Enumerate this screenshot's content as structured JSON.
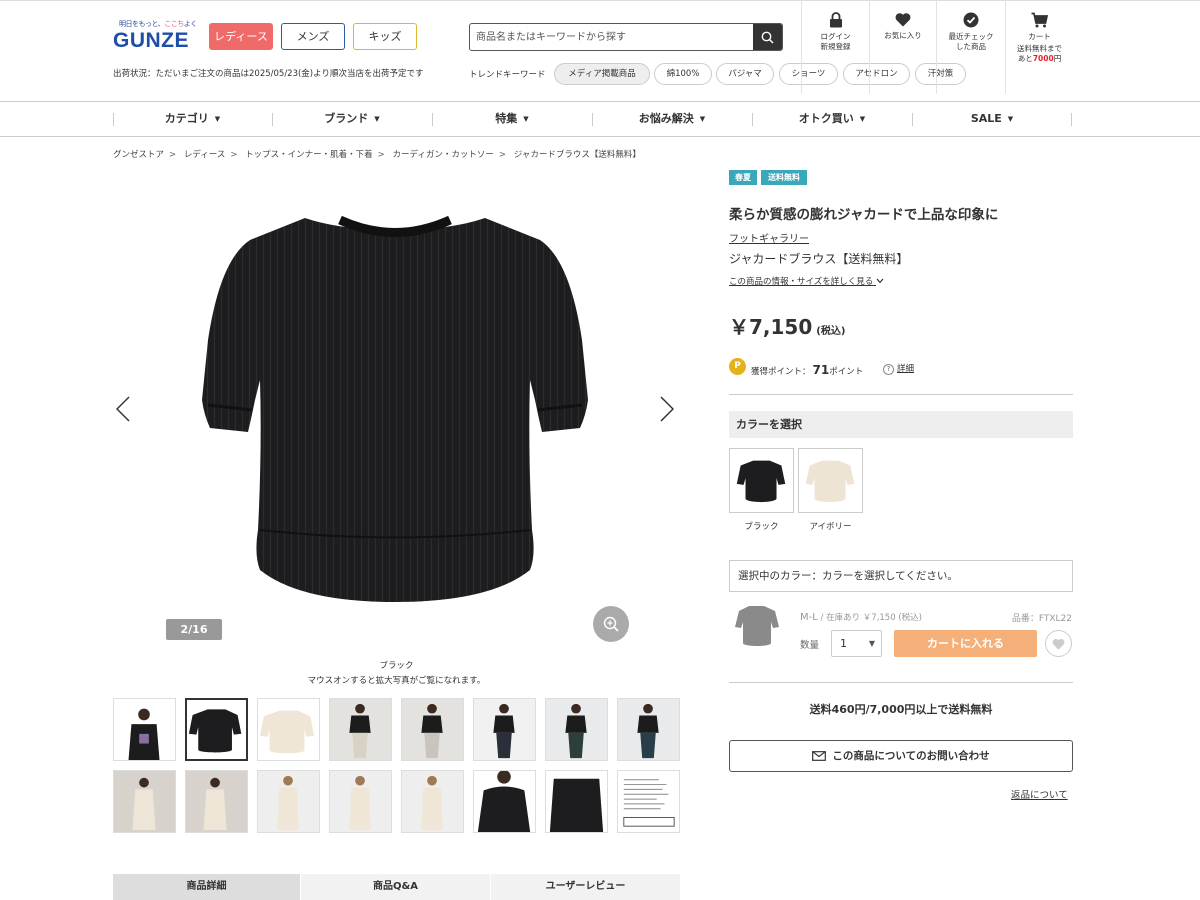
{
  "header": {
    "logo_tagline_pre": "明日をもっと、",
    "logo_tagline_accent": "ここち",
    "logo_tagline_post": "よく",
    "logo_word": "GUNZE",
    "gender_tabs": [
      "レディース",
      "メンズ",
      "キッズ"
    ],
    "shipping_notice": "出荷状況：ただいまご注文の商品は2025/05/23(金)より順次当店を出荷予定です",
    "search_placeholder": "商品名またはキーワードから探す",
    "trend_label": "トレンドキーワード",
    "trend_pills": [
      "メディア掲載商品",
      "綿100%",
      "パジャマ",
      "ショーツ",
      "アセドロン",
      "汗対策"
    ],
    "util": {
      "login_1": "ログイン",
      "login_2": "新規登録",
      "favorites": "お気に入り",
      "recent_1": "最近チェック",
      "recent_2": "した商品",
      "cart": "カート",
      "cart_note_1": "送料無料まで",
      "cart_note_2a": "あと",
      "cart_note_2b": "7000",
      "cart_note_2c": "円"
    }
  },
  "nav": [
    "カテゴリ",
    "ブランド",
    "特集",
    "お悩み解決",
    "オトク買い",
    "SALE"
  ],
  "breadcrumb": [
    "グンゼストア",
    "レディース",
    "トップス・インナー・肌着・下着",
    "カーディガン・カットソー",
    "ジャカードブラウス【送料無料】"
  ],
  "gallery": {
    "counter": "2/16",
    "caption_color": "ブラック",
    "caption_hint": "マウスオンすると拡大写真がご覧になれます。"
  },
  "tabs": [
    "商品詳細",
    "商品Q&A",
    "ユーザーレビュー"
  ],
  "product": {
    "badges": [
      "春夏",
      "送料無料"
    ],
    "headline": "柔らか質感の膨れジャカードで上品な印象に",
    "brand": "フットギャラリー",
    "name": "ジャカードブラウス【送料無料】",
    "details_link": "この商品の情報・サイズを詳しく見る",
    "price": "￥7,150",
    "tax": "(税込)",
    "points_icon": "P",
    "points_label": "獲得ポイント：",
    "points_value": "71",
    "points_unit": "ポイント",
    "points_help": "詳細",
    "color_heading": "カラーを選択",
    "colors": [
      "ブラック",
      "アイボリー"
    ],
    "selected_color_msg": "選択中のカラー：カラーを選択してください。",
    "sku_size": "M-L",
    "sku_stock": " / 在庫あり ￥7,150 (税込)",
    "sku_code": "品番：FTXL22",
    "qty_label": "数量",
    "qty_value": "1",
    "add_to_cart": "カートに入れる",
    "shipping_fee": "送料460円/7,000円以上で送料無料",
    "inquiry": "この商品についてのお問い合わせ",
    "returns": "返品について"
  },
  "colors": {
    "ladies": "#f06a6a",
    "logo_blue": "#1e4ea8",
    "badge_teal": "#3aa8b8",
    "cart_orange": "#f5b07a",
    "points_gold": "#e3b21d"
  }
}
